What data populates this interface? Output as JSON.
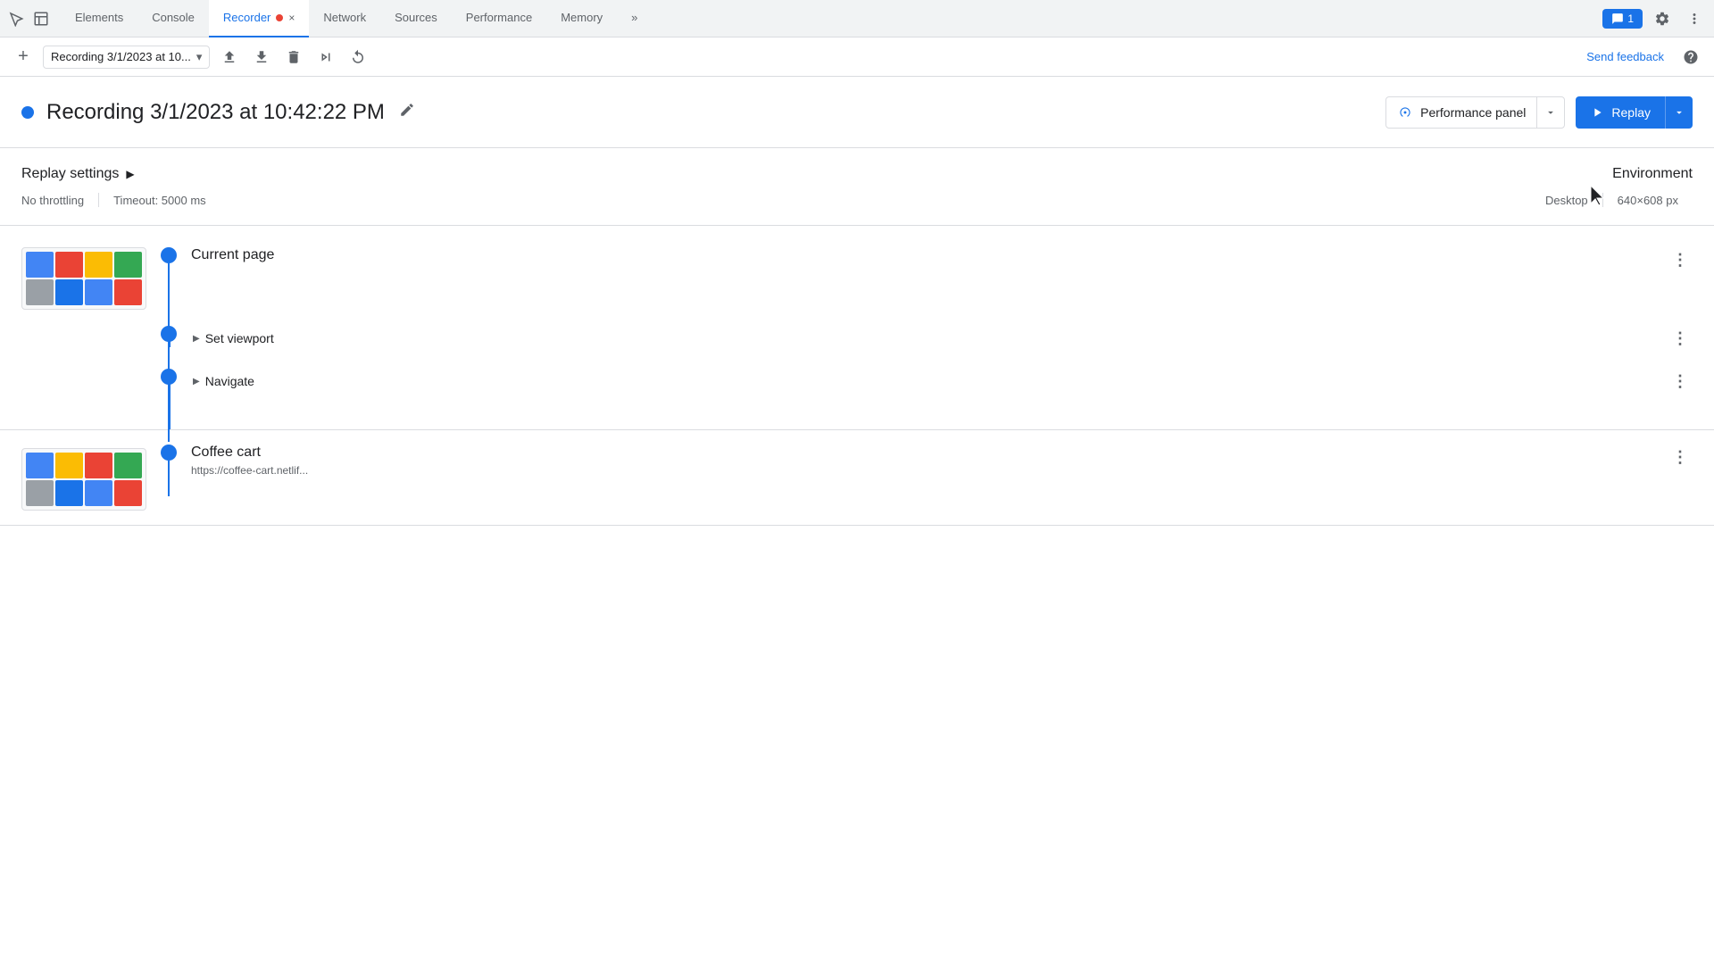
{
  "tabs": {
    "items": [
      {
        "label": "Elements",
        "active": false
      },
      {
        "label": "Console",
        "active": false
      },
      {
        "label": "Recorder",
        "active": true,
        "has_record": true,
        "closeable": true
      },
      {
        "label": "Network",
        "active": false
      },
      {
        "label": "Sources",
        "active": false
      },
      {
        "label": "Performance",
        "active": false
      },
      {
        "label": "Memory",
        "active": false
      }
    ],
    "overflow_icon": "»",
    "notification_count": "1"
  },
  "toolbar": {
    "add_icon": "+",
    "recording_name": "Recording 3/1/2023 at 10...",
    "chevron": "▾",
    "export_icon": "↑",
    "import_icon": "↓",
    "delete_icon": "🗑",
    "play_icon": "▶",
    "refresh_icon": "↺",
    "send_feedback": "Send feedback",
    "help_icon": "?"
  },
  "recording": {
    "title": "Recording 3/1/2023 at 10:42:22 PM",
    "edit_icon": "✏",
    "performance_panel_label": "Performance panel",
    "replay_label": "Replay"
  },
  "settings": {
    "title": "Replay settings",
    "chevron": "▶",
    "throttling": "No throttling",
    "timeout": "Timeout: 5000 ms",
    "environment_title": "Environment",
    "device": "Desktop",
    "resolution": "640×608 px"
  },
  "steps": {
    "group1": {
      "label": "Current page",
      "sub_steps": [
        {
          "label": "Set viewport",
          "has_chevron": true
        },
        {
          "label": "Navigate",
          "has_chevron": true
        }
      ]
    },
    "group2": {
      "label": "Coffee cart",
      "url": "https://coffee-cart.netlif..."
    }
  },
  "icons": {
    "more_vert": "⋮",
    "chevron_right": "▶",
    "chevron_down": "▾",
    "edit": "✎",
    "close": "×"
  },
  "colors": {
    "blue": "#1a73e8",
    "text_primary": "#202124",
    "text_secondary": "#5f6368",
    "border": "#dadce0",
    "bg_light": "#f1f3f4"
  }
}
